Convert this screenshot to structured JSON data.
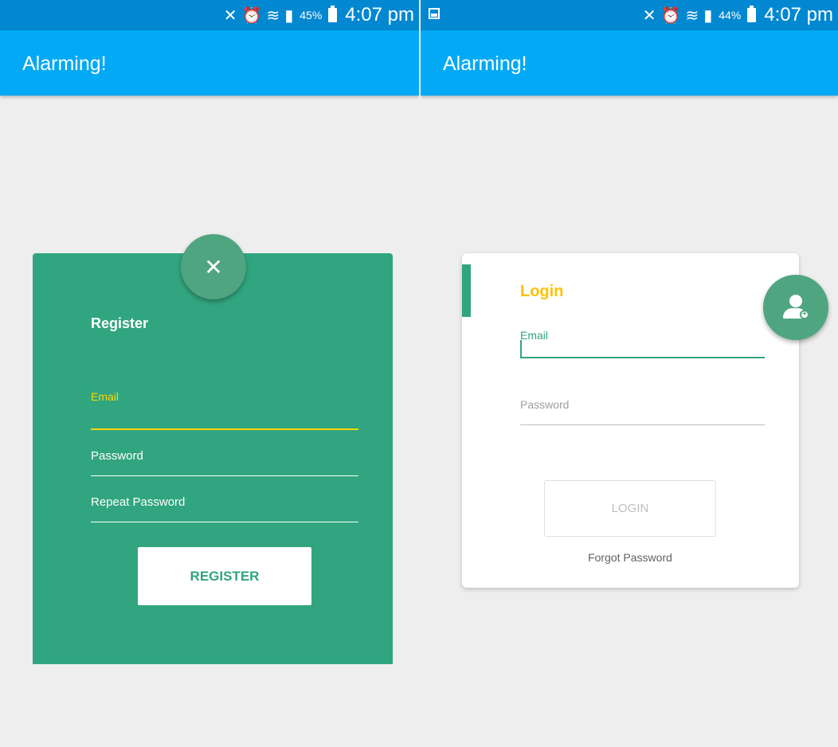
{
  "left_screen": {
    "status_bar": {
      "battery_percent": "45%",
      "time": "4:07 pm"
    },
    "app_bar": {
      "title": "Alarming!"
    },
    "fab": {
      "icon": "close-icon",
      "glyph": "✕"
    },
    "register_card": {
      "title": "Register",
      "email_label": "Email",
      "password_label": "Password",
      "repeat_password_label": "Repeat Password",
      "button_label": "REGISTER"
    }
  },
  "right_screen": {
    "status_bar": {
      "battery_percent": "44%",
      "time": "4:07 pm"
    },
    "app_bar": {
      "title": "Alarming!"
    },
    "fab": {
      "icon": "add-user-icon"
    },
    "login_card": {
      "title": "Login",
      "email_label": "Email",
      "password_label": "Password",
      "button_label": "LOGIN",
      "forgot_password_label": "Forgot Password"
    }
  },
  "colors": {
    "status_bar": "#0288d1",
    "app_bar": "#03a9f4",
    "card_green": "#31a57f",
    "fab_green": "#4fa580",
    "accent_yellow": "#ffd600",
    "login_title": "#ffc107",
    "background": "#eeeeee"
  }
}
